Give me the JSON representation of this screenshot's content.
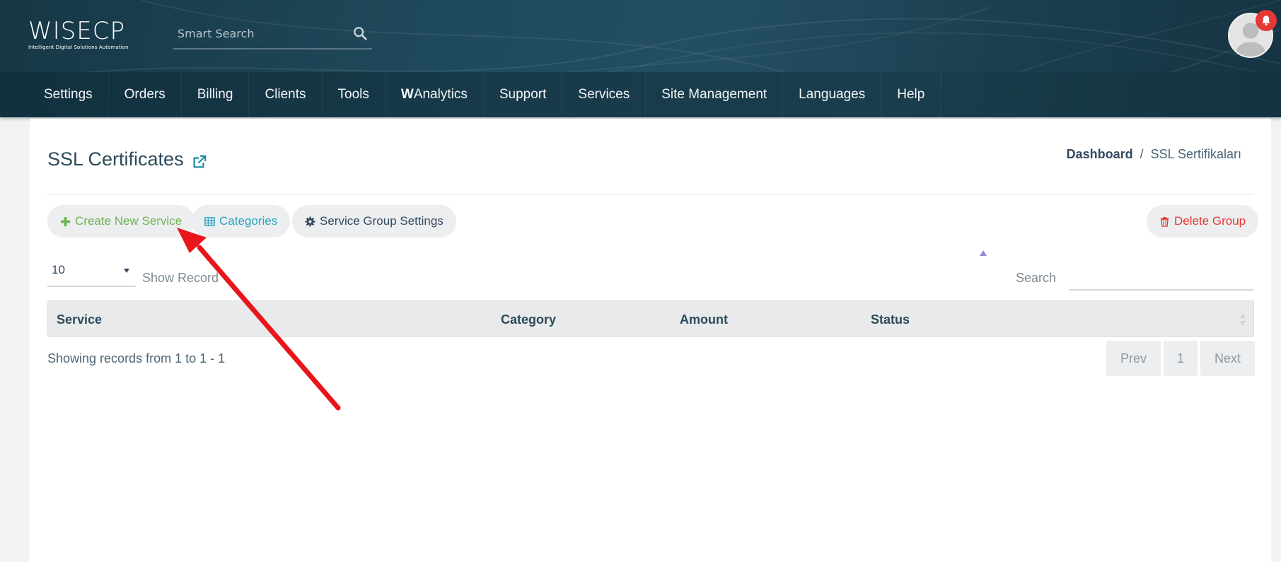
{
  "brand": {
    "logo_text": "WISECP",
    "logo_tagline": "Intelligent Digital Solutions Automation"
  },
  "header": {
    "search_placeholder": "Smart Search",
    "notification_color": "#e53935"
  },
  "nav": {
    "items": [
      {
        "label": "Settings"
      },
      {
        "label": "Orders"
      },
      {
        "label": "Billing"
      },
      {
        "label": "Clients"
      },
      {
        "label": "Tools"
      },
      {
        "label_bold": "W",
        "label": "Analytics"
      },
      {
        "label": "Support"
      },
      {
        "label": "Services"
      },
      {
        "label": "Site Management"
      },
      {
        "label": "Languages"
      },
      {
        "label": "Help"
      }
    ]
  },
  "page": {
    "title": "SSL Certificates",
    "breadcrumb": {
      "home": "Dashboard",
      "separator": "/",
      "current": "SSL Sertifikaları"
    }
  },
  "actions": {
    "create": "Create New Service",
    "categories": "Categories",
    "group_settings": "Service Group Settings",
    "delete_group": "Delete Group"
  },
  "table_controls": {
    "page_length": "10",
    "show_record": "Show Record",
    "search_label": "Search"
  },
  "table": {
    "columns": [
      "Service",
      "Category",
      "Amount",
      "Status",
      ""
    ],
    "rows": []
  },
  "footer": {
    "showing": "Showing records from 1 to 1 - 1",
    "prev": "Prev",
    "page": "1",
    "next": "Next"
  },
  "colors": {
    "create": "#6db352",
    "categories": "#2aa5c0",
    "delete": "#e53935",
    "annotation_arrow": "#e8161b"
  },
  "icons": {
    "search": "search-icon",
    "external": "external-link-icon",
    "plus": "plus-icon",
    "table": "table-icon",
    "gear": "gear-icon",
    "trash": "trash-icon",
    "bell": "bell-icon",
    "avatar": "user-avatar-icon"
  }
}
